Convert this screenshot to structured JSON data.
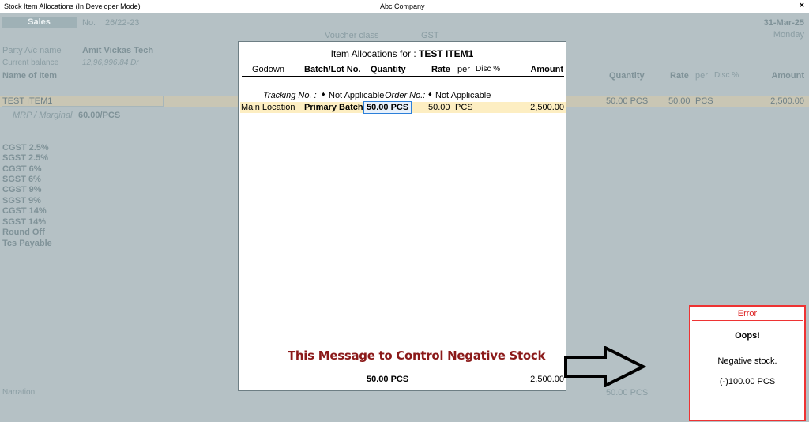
{
  "window": {
    "title": "Stock Item Allocations (In Developer Mode)",
    "company": "Abc Company",
    "close_glyph": "×"
  },
  "voucher": {
    "type": "Sales",
    "no_label": "No.",
    "number": "26/22-23",
    "voucher_class_label": "Voucher class",
    "voucher_class_value": "GST",
    "date": "31-Mar-25",
    "day": "Monday",
    "party_label": "Party A/c name",
    "party_value": "Amit Vickas Tech",
    "balance_label": "Current balance",
    "balance_value": "12,96,996.84 Dr"
  },
  "main_table": {
    "col_name": "Name of Item",
    "col_quantity": "Quantity",
    "col_rate": "Rate",
    "col_per": "per",
    "col_disc": "Disc %",
    "col_amount": "Amount",
    "item_name": "TEST ITEM1",
    "item_quantity": "50.00 PCS",
    "item_rate": "50.00",
    "item_per": "PCS",
    "item_amount": "2,500.00",
    "mrp_label": "MRP / Marginal",
    "mrp_value": "60.00/PCS"
  },
  "ledgers": [
    "CGST 2.5%",
    "SGST 2.5%",
    "CGST 6%",
    "SGST 6%",
    "CGST 9%",
    "SGST 9%",
    "CGST 14%",
    "SGST 14%",
    "Round Off",
    "Tcs Payable"
  ],
  "narration": {
    "label": "Narration:",
    "total_quantity": "50.00 PCS"
  },
  "modal": {
    "title_prefix": "Item Allocations for :",
    "title_item": "TEST ITEM1",
    "col_godown": "Godown",
    "col_batch": "Batch/Lot No.",
    "col_quantity": "Quantity",
    "col_rate": "Rate",
    "col_per": "per",
    "col_disc": "Disc %",
    "col_amount": "Amount",
    "tracking_label": "Tracking No. :",
    "tracking_value": "Not Applicable",
    "order_label": "Order No.:",
    "order_value": "Not Applicable",
    "bullet": "♦",
    "row": {
      "godown": "Main Location",
      "batch": "Primary Batch",
      "quantity": "50.00 PCS",
      "rate": "50.00",
      "per": "PCS",
      "amount": "2,500.00"
    },
    "total_quantity": "50.00 PCS",
    "total_amount": "2,500.00"
  },
  "annotation": {
    "text": "This Message to Control Negative Stock",
    "arrow_icon": "right-arrow-outline",
    "color": "#8b1a1a"
  },
  "error": {
    "title": "Error",
    "heading": "Oops!",
    "message": "Negative stock.",
    "amount": "(-)100.00 PCS",
    "border_color": "#e33333"
  },
  "colors": {
    "background": "#b5c1c5",
    "selected_row": "#fdeec2",
    "focus_border": "#2c7fd9"
  }
}
